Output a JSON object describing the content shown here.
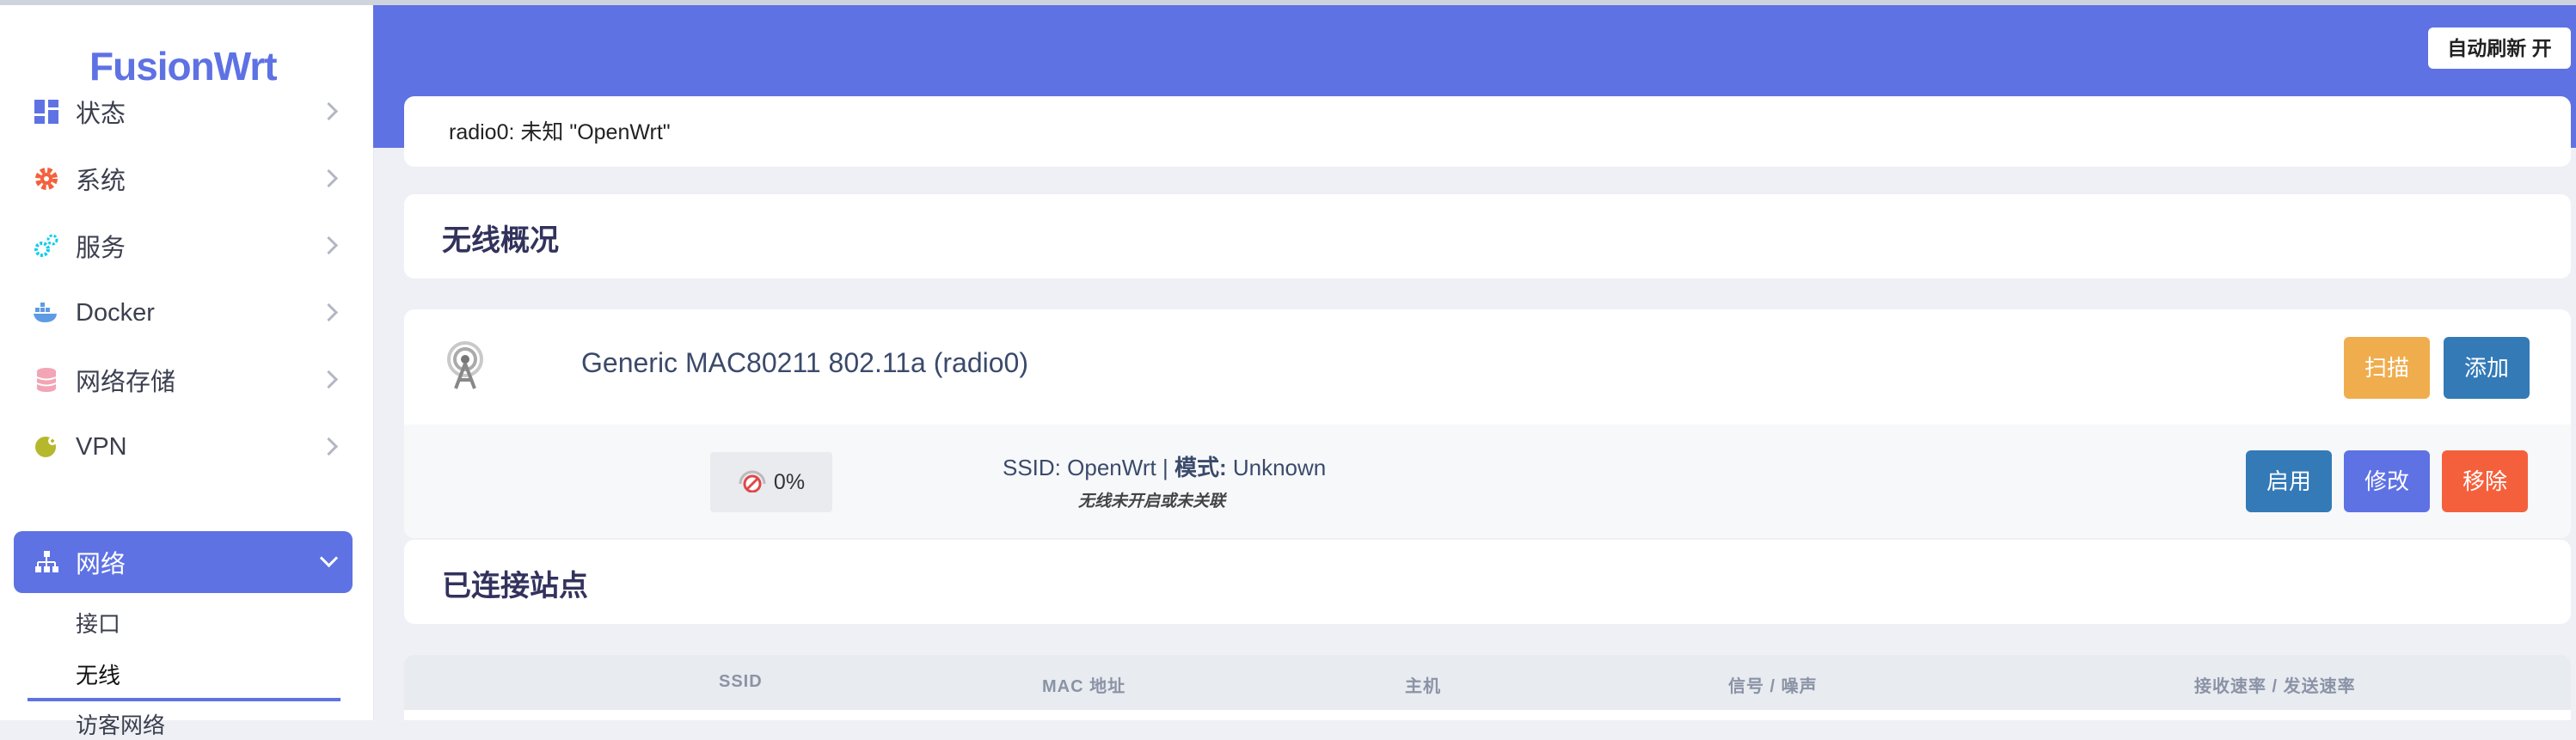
{
  "sidebar": {
    "logo": "FusionWrt",
    "items": [
      {
        "label": "状态",
        "icon": "dashboard-icon"
      },
      {
        "label": "系统",
        "icon": "gear-icon"
      },
      {
        "label": "服务",
        "icon": "gears-icon"
      },
      {
        "label": "Docker",
        "icon": "docker-icon"
      },
      {
        "label": "网络存储",
        "icon": "database-icon"
      },
      {
        "label": "VPN",
        "icon": "vpn-icon"
      },
      {
        "label": "网络",
        "icon": "network-icon"
      }
    ],
    "sub_items": [
      "接口",
      "无线",
      "访客网络"
    ]
  },
  "header": {
    "refresh_label": "自动刷新 开"
  },
  "status": {
    "text": "radio0: 未知 \"OpenWrt\""
  },
  "wireless_overview": {
    "title": "无线概况",
    "radio": {
      "name": "Generic MAC80211 802.11a (radio0)",
      "scan_label": "扫描",
      "add_label": "添加"
    },
    "network": {
      "signal": "0%",
      "ssid_prefix": "SSID:",
      "ssid_value": "OpenWrt",
      "separator": "|",
      "mode_label": "模式:",
      "mode_value": "Unknown",
      "note": "无线未开启或未关联",
      "enable_label": "启用",
      "edit_label": "修改",
      "remove_label": "移除"
    }
  },
  "stations": {
    "title": "已连接站点",
    "columns": [
      "SSID",
      "MAC 地址",
      "主机",
      "信号 / 噪声",
      "接收速率 / 发送速率"
    ]
  },
  "colors": {
    "accent": "#5e72e4",
    "scan": "#f0ad4e",
    "add": "#337ab7",
    "enable": "#337ab7",
    "edit": "#5e72e4",
    "remove": "#f5603c"
  }
}
